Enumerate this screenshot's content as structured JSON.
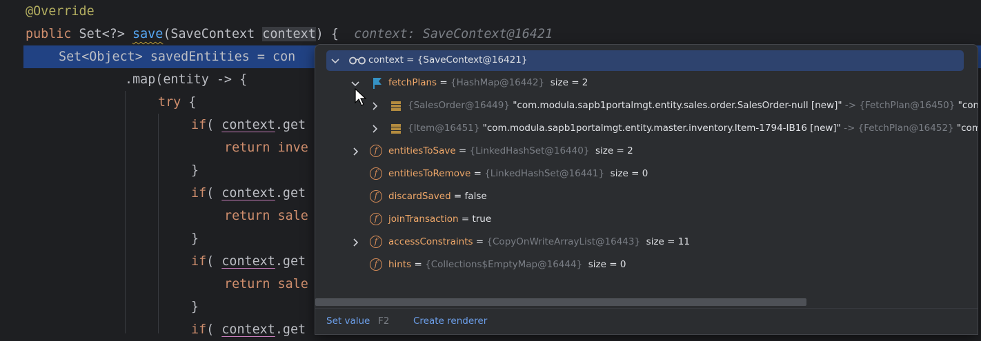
{
  "editor": {
    "lines": [
      {
        "indent": 0,
        "tokens": [
          {
            "t": "@Override",
            "c": "ann"
          }
        ]
      },
      {
        "indent": 0,
        "tokens": [
          {
            "t": "public ",
            "c": "kw"
          },
          {
            "t": "Set<?> ",
            "c": ""
          },
          {
            "t": "save",
            "c": "fn"
          },
          {
            "t": "(SaveContext ",
            "c": ""
          },
          {
            "t": "context",
            "c": "param-hl"
          },
          {
            "t": ") {",
            "c": ""
          },
          {
            "t": "  context: SaveContext@16421",
            "c": "inlay"
          }
        ]
      },
      {
        "indent": 1,
        "tokens": [
          {
            "t": "Set<Object> savedEntities = con",
            "c": ""
          }
        ],
        "highlighted": true
      },
      {
        "indent": 3,
        "tokens": [
          {
            "t": ".map(entity -> {",
            "c": ""
          }
        ]
      },
      {
        "indent": 4,
        "tokens": [
          {
            "t": "try ",
            "c": "kw"
          },
          {
            "t": "{",
            "c": ""
          }
        ]
      },
      {
        "indent": 5,
        "tokens": [
          {
            "t": "if",
            "c": "kw"
          },
          {
            "t": "( ",
            "c": ""
          },
          {
            "t": "context",
            "c": "param"
          },
          {
            "t": ".get",
            "c": ""
          }
        ]
      },
      {
        "indent": 6,
        "tokens": [
          {
            "t": "return ",
            "c": "kw"
          },
          {
            "t": "inve",
            "c": "kw"
          }
        ]
      },
      {
        "indent": 5,
        "tokens": [
          {
            "t": "}",
            "c": ""
          }
        ]
      },
      {
        "indent": 5,
        "tokens": [
          {
            "t": "if",
            "c": "kw"
          },
          {
            "t": "( ",
            "c": ""
          },
          {
            "t": "context",
            "c": "param"
          },
          {
            "t": ".get",
            "c": ""
          }
        ]
      },
      {
        "indent": 6,
        "tokens": [
          {
            "t": "return ",
            "c": "kw"
          },
          {
            "t": "sale",
            "c": "kw"
          }
        ]
      },
      {
        "indent": 5,
        "tokens": [
          {
            "t": "}",
            "c": ""
          }
        ]
      },
      {
        "indent": 5,
        "tokens": [
          {
            "t": "if",
            "c": "kw"
          },
          {
            "t": "( ",
            "c": ""
          },
          {
            "t": "context",
            "c": "param"
          },
          {
            "t": ".get",
            "c": ""
          }
        ]
      },
      {
        "indent": 6,
        "tokens": [
          {
            "t": "return ",
            "c": "kw"
          },
          {
            "t": "sale",
            "c": "kw"
          }
        ]
      },
      {
        "indent": 5,
        "tokens": [
          {
            "t": "}",
            "c": ""
          }
        ]
      },
      {
        "indent": 5,
        "tokens": [
          {
            "t": "if",
            "c": "kw"
          },
          {
            "t": "( ",
            "c": ""
          },
          {
            "t": "context",
            "c": "param"
          },
          {
            "t": ".get",
            "c": ""
          }
        ]
      }
    ]
  },
  "popup": {
    "root": {
      "name": "context",
      "eq": " = ",
      "value": "{SaveContext@16421}",
      "icon": "glasses-icon"
    },
    "fetchPlans": {
      "name": "fetchPlans",
      "eq": " = ",
      "ref": "{HashMap@16442}",
      "size": "size = 2",
      "icon": "flag-icon"
    },
    "entries": [
      {
        "key_ref": "{SalesOrder@16449}",
        "key_str": "\"com.modula.sapb1portalmgt.entity.sales.order.SalesOrder-null [new]\"",
        "arrow": " -> ",
        "val_ref": "{FetchPlan@16450}",
        "val_str": "\"com.modula"
      },
      {
        "key_ref": "{Item@16451}",
        "key_str": "\"com.modula.sapb1portalmgt.entity.master.inventory.Item-1794-IB16 [new]\"",
        "arrow": " -> ",
        "val_ref": "{FetchPlan@16452}",
        "val_str": "\"com.modula"
      }
    ],
    "fields": [
      {
        "name": "entitiesToSave",
        "eq": " = ",
        "ref": "{LinkedHashSet@16440}",
        "extra": "size = 2",
        "expandable": true
      },
      {
        "name": "entitiesToRemove",
        "eq": " = ",
        "ref": "{LinkedHashSet@16441}",
        "extra": "size = 0",
        "expandable": false
      },
      {
        "name": "discardSaved",
        "eq": " = ",
        "ref": "",
        "extra": "false",
        "expandable": false
      },
      {
        "name": "joinTransaction",
        "eq": " = ",
        "ref": "",
        "extra": "true",
        "expandable": false
      },
      {
        "name": "accessConstraints",
        "eq": " = ",
        "ref": "{CopyOnWriteArrayList@16443}",
        "extra": "size = 11",
        "expandable": true
      },
      {
        "name": "hints",
        "eq": " = ",
        "ref": "{Collections$EmptyMap@16444}",
        "extra": "size = 0",
        "expandable": false
      }
    ],
    "field_icon_letter": "f",
    "footer": {
      "set_value": "Set value",
      "set_value_key": "F2",
      "create_renderer": "Create renderer"
    }
  },
  "colors": {
    "background": "#1e1f22",
    "popup": "#2b2d30",
    "selection": "#2e436e",
    "line_highlight": "#214283",
    "field_name": "#f0a869",
    "link": "#6c9fea"
  }
}
